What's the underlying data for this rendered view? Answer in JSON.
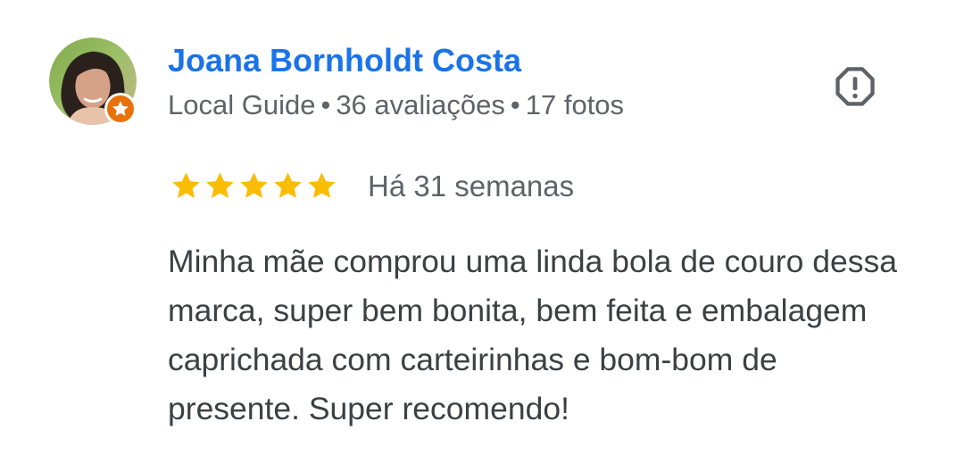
{
  "review": {
    "author_name": "Joana Bornholdt Costa",
    "author_badge": "Local Guide",
    "review_count": "36 avaliações",
    "photo_count": "17 fotos",
    "separator": "•",
    "rating": 5,
    "rating_max": 5,
    "time_ago": "Há 31 semanas",
    "text": "Minha mãe comprou uma linda bola de couro dessa marca, super bem bonita, bem feita e embalagem caprichada com carteirinhas e bom-bom de presente. Super recomendo!",
    "icons": {
      "avatar": "avatar-photo",
      "badge": "local-guide-star-icon",
      "flag": "report-flag-icon",
      "star": "star-icon"
    }
  },
  "colors": {
    "author_name": "#1a73e8",
    "meta_text": "#5f6368",
    "body_text": "#3c4043",
    "star": "#fbbc04",
    "badge": "#e8710a",
    "flag_icon": "#5f6368"
  }
}
